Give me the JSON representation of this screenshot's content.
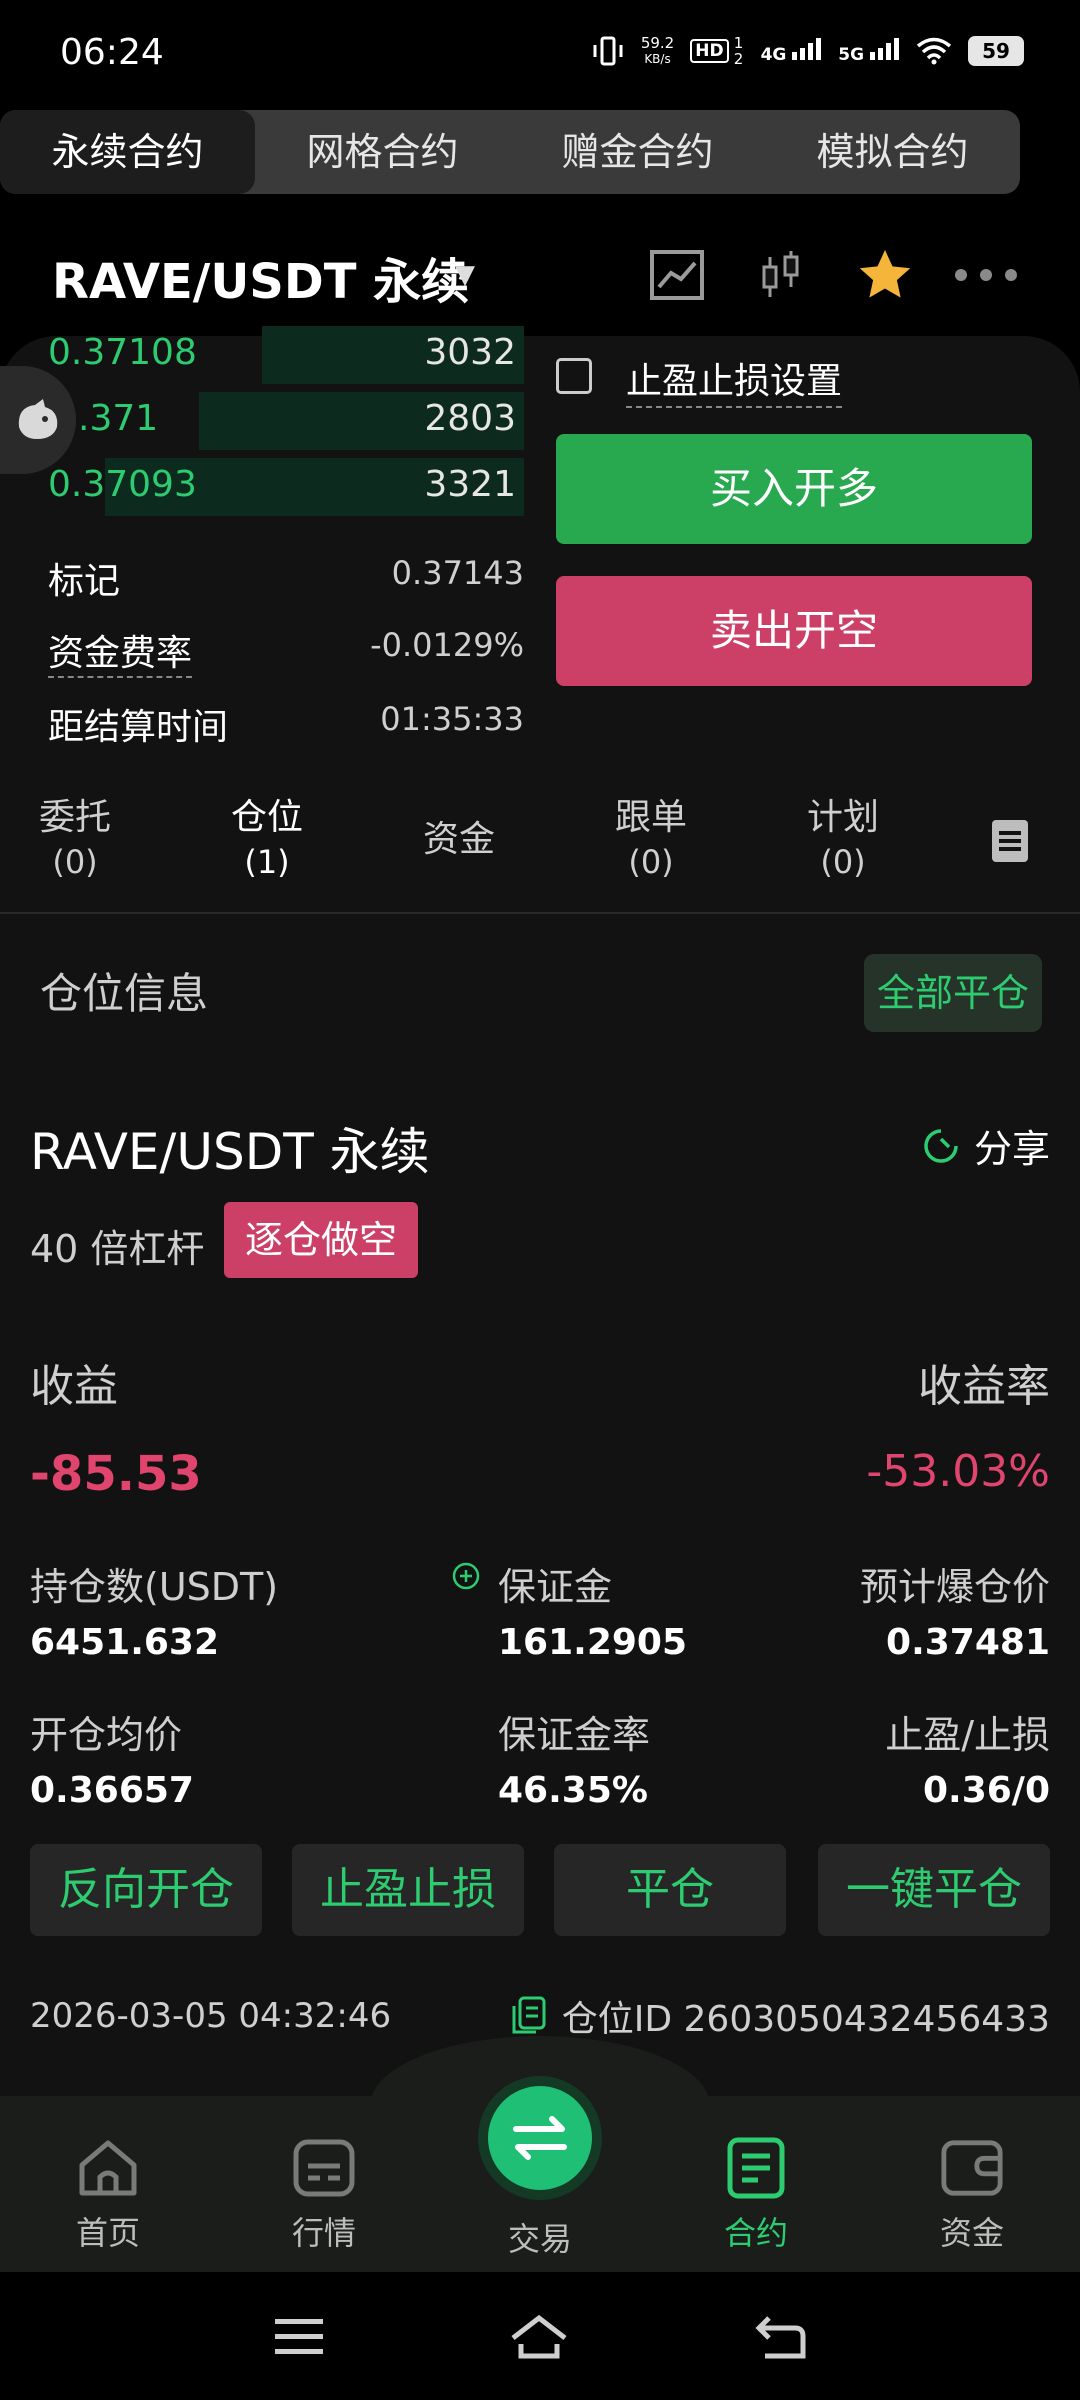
{
  "status_bar": {
    "time": "06:24",
    "net_speed_top": "59.2",
    "net_speed_unit": "KB/s",
    "hd_badge": "HD",
    "hd_sub": "1 2",
    "signal_4g": "4G",
    "signal_5g": "5G",
    "battery": "59"
  },
  "contract_tabs": [
    {
      "label": "永续合约",
      "active": true
    },
    {
      "label": "网格合约",
      "active": false
    },
    {
      "label": "赠金合约",
      "active": false
    },
    {
      "label": "模拟合约",
      "active": false
    }
  ],
  "header": {
    "pair": "RAVE/USDT  永续",
    "caret": "▼"
  },
  "orderbook": [
    {
      "price": "0.37108",
      "qty": "3032",
      "depth": 0.5
    },
    {
      "price": ".371",
      "qty": "2803",
      "depth": 0.62
    },
    {
      "price": "0.37093",
      "qty": "3321",
      "depth": 0.8
    }
  ],
  "market_info": {
    "mark_label": "标记",
    "mark_value": "0.37143",
    "funding_label": "资金费率",
    "funding_value": "-0.0129%",
    "settle_label": "距结算时间",
    "settle_value": "01:35:33"
  },
  "trade": {
    "tpsl_label": "止盈止损设置",
    "buy_label": "买入开多",
    "sell_label": "卖出开空"
  },
  "position_tabs": [
    {
      "label": "委托",
      "count": "(0)"
    },
    {
      "label": "仓位",
      "count": "(1)"
    },
    {
      "label": "资金",
      "count": ""
    },
    {
      "label": "跟单",
      "count": "(0)"
    },
    {
      "label": "计划",
      "count": "(0)"
    }
  ],
  "position": {
    "section_title": "仓位信息",
    "close_all": "全部平仓",
    "pair": "RAVE/USDT 永续",
    "share": "分享",
    "leverage": "40 倍杠杆",
    "mode": "逐仓做空",
    "pnl_label": "收益",
    "pnl_value": "-85.53",
    "roe_label": "收益率",
    "roe_value": "-53.03%",
    "size_label": "持仓数(USDT)",
    "size_value": "6451.632",
    "margin_label": "保证金",
    "margin_value": "161.2905",
    "liq_label": "预计爆仓价",
    "liq_value": "0.37481",
    "entry_label": "开仓均价",
    "entry_value": "0.36657",
    "margin_rate_label": "保证金率",
    "margin_rate_value": "46.35%",
    "tpsl_label": "止盈/止损",
    "tpsl_value": "0.36/0",
    "actions": [
      "反向开仓",
      "止盈止损",
      "平仓",
      "一键平仓"
    ],
    "timestamp": "2026-03-05 04:32:46",
    "id_text": "仓位ID 2603050432456433"
  },
  "bottom_nav": [
    {
      "label": "首页",
      "icon": "home-icon"
    },
    {
      "label": "行情",
      "icon": "market-icon"
    },
    {
      "label": "交易",
      "icon": "trade-icon"
    },
    {
      "label": "合约",
      "icon": "contract-icon"
    },
    {
      "label": "资金",
      "icon": "wallet-icon"
    }
  ],
  "colors": {
    "green": "#2ecc71",
    "red": "#e0456e",
    "buy": "#28a84f",
    "sell": "#cc4068"
  }
}
